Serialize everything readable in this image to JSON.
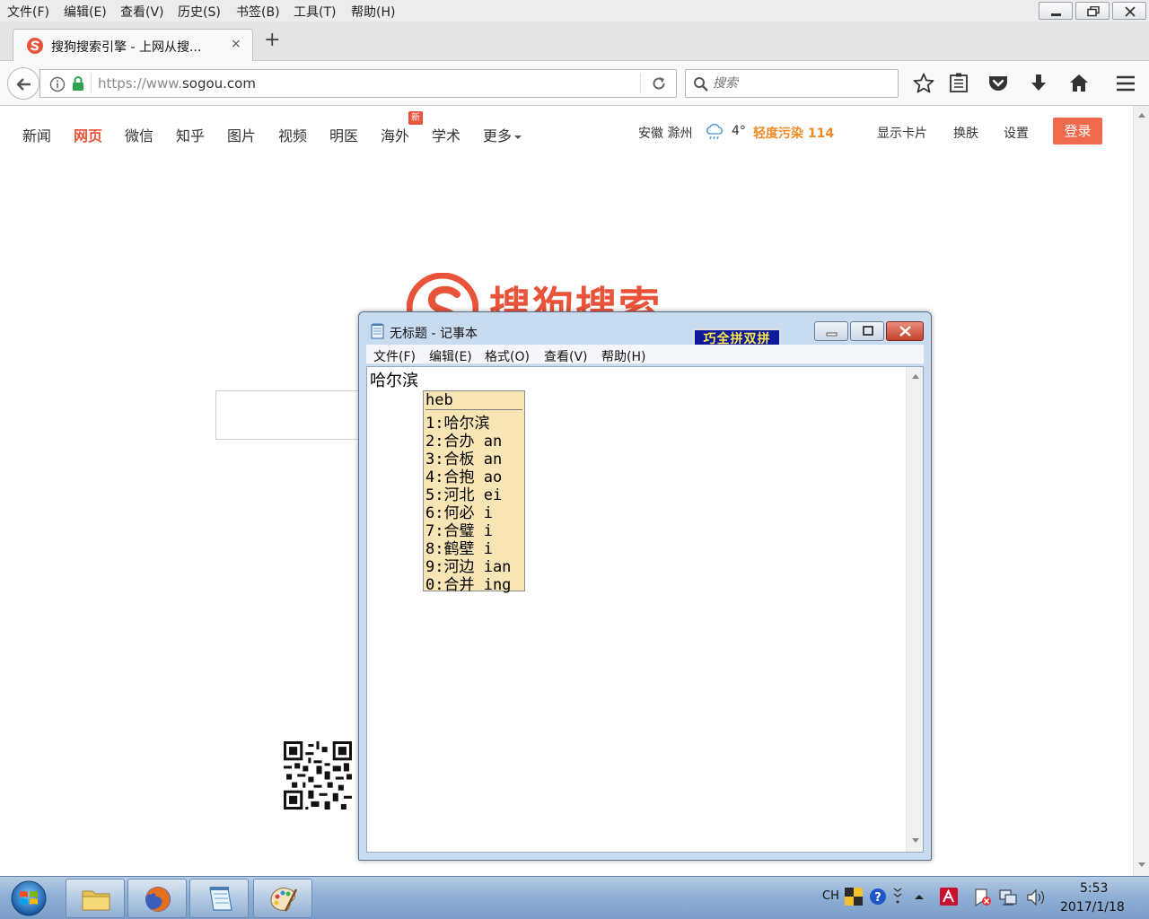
{
  "browser": {
    "menu": [
      "文件(F)",
      "编辑(E)",
      "查看(V)",
      "历史(S)",
      "书签(B)",
      "工具(T)",
      "帮助(H)"
    ],
    "tab_title": "搜狗搜索引擎 - 上网从搜...",
    "tab_close": "×",
    "new_tab": "+",
    "url_scheme": "https://www.",
    "url_host": "sogou.com",
    "search_placeholder": "搜索"
  },
  "sogou": {
    "nav": [
      "新闻",
      "网页",
      "微信",
      "知乎",
      "图片",
      "视频",
      "明医",
      "海外",
      "学术",
      "更多"
    ],
    "active_nav": "网页",
    "new_badge": "新",
    "location": "安徽 滁州",
    "temperature": "4°",
    "air_quality": "轻度污染 114",
    "right_links": [
      "显示卡片",
      "换肤",
      "设置"
    ],
    "login": "登录",
    "logo_text": "搜狗搜索",
    "colors": {
      "accent": "#e8533a",
      "air": "#f08a24",
      "login_bg": "#f06a4d"
    }
  },
  "notepad": {
    "title": "无标题 - 记事本",
    "menu": [
      "文件(F)",
      "编辑(E)",
      "格式(O)",
      "查看(V)",
      "帮助(H)"
    ],
    "content": "哈尔滨",
    "ime_status": "巧全拼双拼"
  },
  "ime_candidates": {
    "composition": "heb",
    "items": [
      "1:哈尔滨",
      "2:合办 an",
      "3:合板 an",
      "4:合抱 ao",
      "5:河北 ei",
      "6:何必 i",
      "7:合璧 i",
      "8:鹤壁 i",
      "9:河边 ian",
      "0:合并 ing"
    ]
  },
  "taskbar": {
    "lang": "CH",
    "time": "5:53",
    "date": "2017/1/18"
  }
}
